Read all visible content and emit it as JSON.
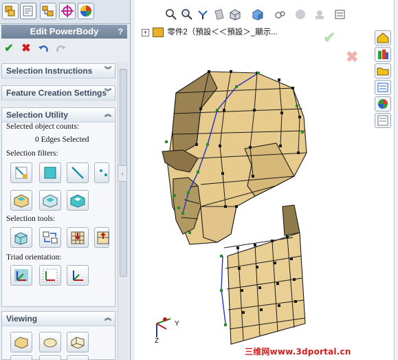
{
  "panel": {
    "title": "Edit PowerBody",
    "help": "?",
    "groups": {
      "selection_instructions": "Selection Instructions",
      "feature_creation": "Feature Creation Settings",
      "selection_utility": "Selection Utility",
      "viewing": "Viewing"
    },
    "selected_counts_label": "Selected object counts:",
    "selected_counts_value": "0 Edges Selected",
    "selection_filters_label": "Selection filters:",
    "selection_tools_label": "Selection tools:",
    "triad_label": "Triad orientation:"
  },
  "tree": {
    "item": "零件2（預設＜＜預設＞_顯示..."
  },
  "triad": {
    "y": "Y",
    "z": "Z"
  },
  "watermark": "三维网www.3dportal.cn",
  "colors": {
    "accent": "#6e8299",
    "model_face": "#e4c98a",
    "model_edge": "#1a1a1a",
    "guide_line": "#2431c9",
    "vertex": "#2b8a2b"
  }
}
